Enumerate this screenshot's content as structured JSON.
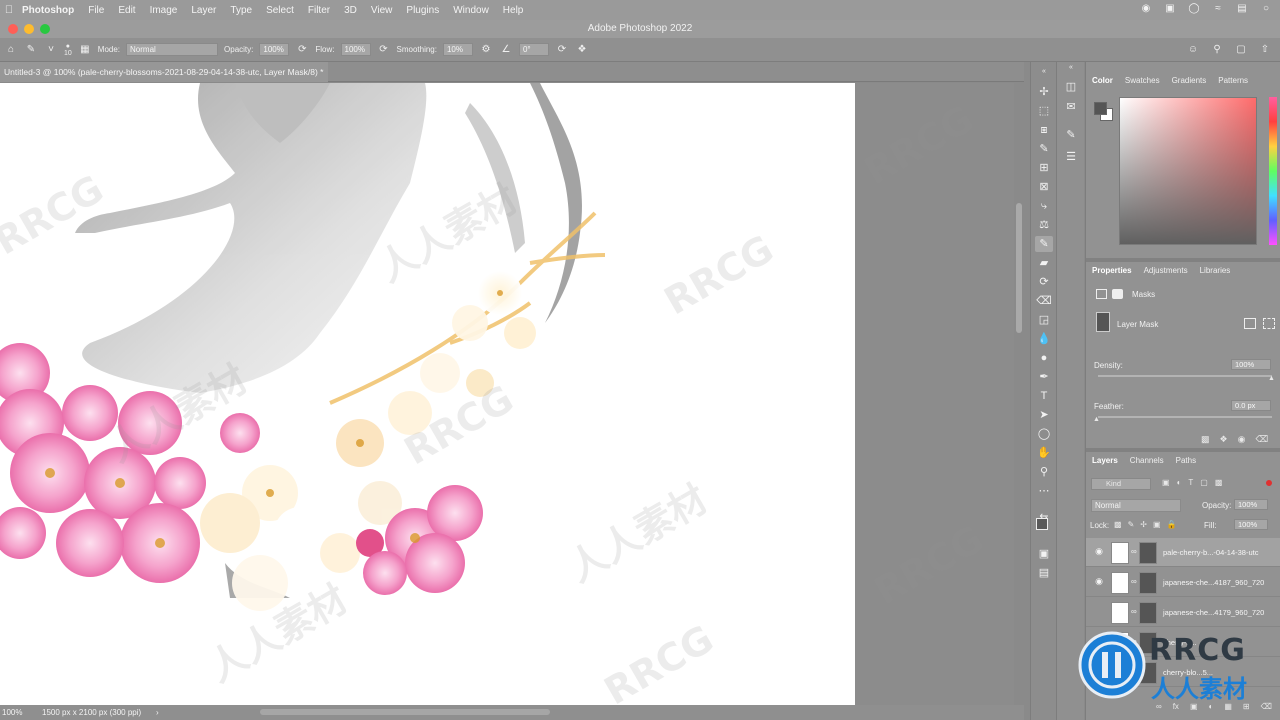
{
  "menubar": {
    "app": "Photoshop",
    "items": [
      "File",
      "Edit",
      "Image",
      "Layer",
      "Type",
      "Select",
      "Filter",
      "3D",
      "View",
      "Plugins",
      "Window",
      "Help"
    ]
  },
  "window": {
    "title": "Adobe Photoshop 2022"
  },
  "options": {
    "brush_size": "10",
    "mode_label": "Mode:",
    "mode_value": "Normal",
    "opacity_label": "Opacity:",
    "opacity_value": "100%",
    "flow_label": "Flow:",
    "flow_value": "100%",
    "smoothing_label": "Smoothing:",
    "smoothing_value": "10%",
    "angle_value": "0°"
  },
  "document": {
    "tab_title": "Untitled-3 @ 100% (pale-cherry-blossoms-2021-08-29-04-14-38-utc, Layer Mask/8) *"
  },
  "status": {
    "zoom": "100%",
    "doc_info": "1500 px x 2100 px (300 ppi)"
  },
  "color_panel": {
    "tabs": [
      "Color",
      "Swatches",
      "Gradients",
      "Patterns"
    ]
  },
  "properties_panel": {
    "tabs": [
      "Properties",
      "Adjustments",
      "Libraries"
    ],
    "masks_label": "Masks",
    "layer_mask_label": "Layer Mask",
    "density_label": "Density:",
    "density_value": "100%",
    "feather_label": "Feather:",
    "feather_value": "0.0 px"
  },
  "layers_panel": {
    "tabs": [
      "Layers",
      "Channels",
      "Paths"
    ],
    "kind_value": "Kind",
    "blend_mode": "Normal",
    "opacity_label": "Opacity:",
    "opacity_value": "100%",
    "lock_label": "Lock:",
    "fill_label": "Fill:",
    "fill_value": "100%",
    "layers": [
      {
        "name": "pale-cherry-b...-04-14-38-utc"
      },
      {
        "name": "japanese-che...4187_960_720"
      },
      {
        "name": "japanese-che...4179_960_720"
      },
      {
        "name": "cherry-b..."
      },
      {
        "name": "cherry-blo...5..."
      }
    ]
  },
  "watermarks": [
    "RRCG",
    "人人素材"
  ],
  "logo": {
    "text_top": "RRCG",
    "text_bottom": "人人素材"
  },
  "colors": {
    "close": "#ff5f57",
    "minimize": "#febc2e",
    "zoom": "#28c840",
    "blossom_pink": "#f08ab8",
    "logo_blue": "#1c7fd6"
  }
}
